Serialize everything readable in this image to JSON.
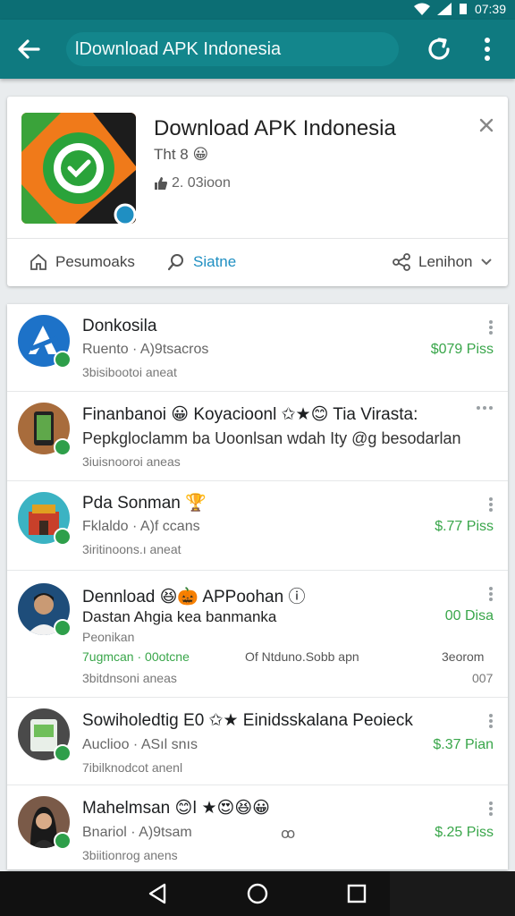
{
  "status_bar": {
    "time": "07:39"
  },
  "app_bar": {
    "search_text": "lDownload APK Indonesia",
    "back_icon": "arrow-left-icon",
    "refresh_icon": "refresh-icon",
    "more_icon": "more-vert-icon"
  },
  "featured": {
    "title": "Download APK Indonesia",
    "subtitle": "Tht 8 😀",
    "meta": "2. 03ioon",
    "actions": [
      {
        "label": "Pesumoaks",
        "icon": "home-icon"
      },
      {
        "label": "Siatne",
        "icon": "search-icon"
      },
      {
        "label": "Lenihon",
        "icon": "share-icon"
      }
    ]
  },
  "list": [
    {
      "title": "Donkosila",
      "line1": "Ruento · A)9tsacros",
      "line2": "3bisibootoi aneat",
      "price": "$079 Piss"
    },
    {
      "title": "Finanbanoi 😀 Koyacioonl ✩★😊 Tia Virasta:",
      "line1": "Pepkgloclamm ba Uoonlsan wdah Ity @g besodarlan",
      "line2": "3iuisnooroi aneas",
      "price": ""
    },
    {
      "title": "Pda Sonman 🏆",
      "line1": "Fklaldo · A)f ccans",
      "line2": "3iritinoons.ı aneat",
      "price": "$.77 Piss"
    },
    {
      "title": "Dennload 😆🎃 APPoohan ⓘ",
      "line1": "Dastan Ahgia kea banmanka",
      "line2": "Peonikan",
      "line3_left": "7ugmcan · 00otcne",
      "line3_mid": "Of Ntduno.Sobb apn",
      "line3_right": "3eorom",
      "footer_left": "3bitdnsoni aneas",
      "footer_right": "007",
      "price": "00 Disa"
    },
    {
      "title": "Sowiholedtig E0 ✩★ Einidsskalana Peoieck",
      "line1": "Auclioo · ASıl snıs",
      "line2": "7ibilknodcot anenl",
      "price": "$.37 Pian"
    },
    {
      "title": "Mahelmsan 😊ǀ ★😍😆😀",
      "line1": "Bnariol · A)9tsam",
      "line1_mid": "ꝏ",
      "line2": "3biitionrog anens",
      "price": "$.25 Piss"
    }
  ],
  "colors": {
    "primary": "#0f7a80",
    "accent_green": "#39a64a",
    "link_blue": "#1f8fc2"
  }
}
